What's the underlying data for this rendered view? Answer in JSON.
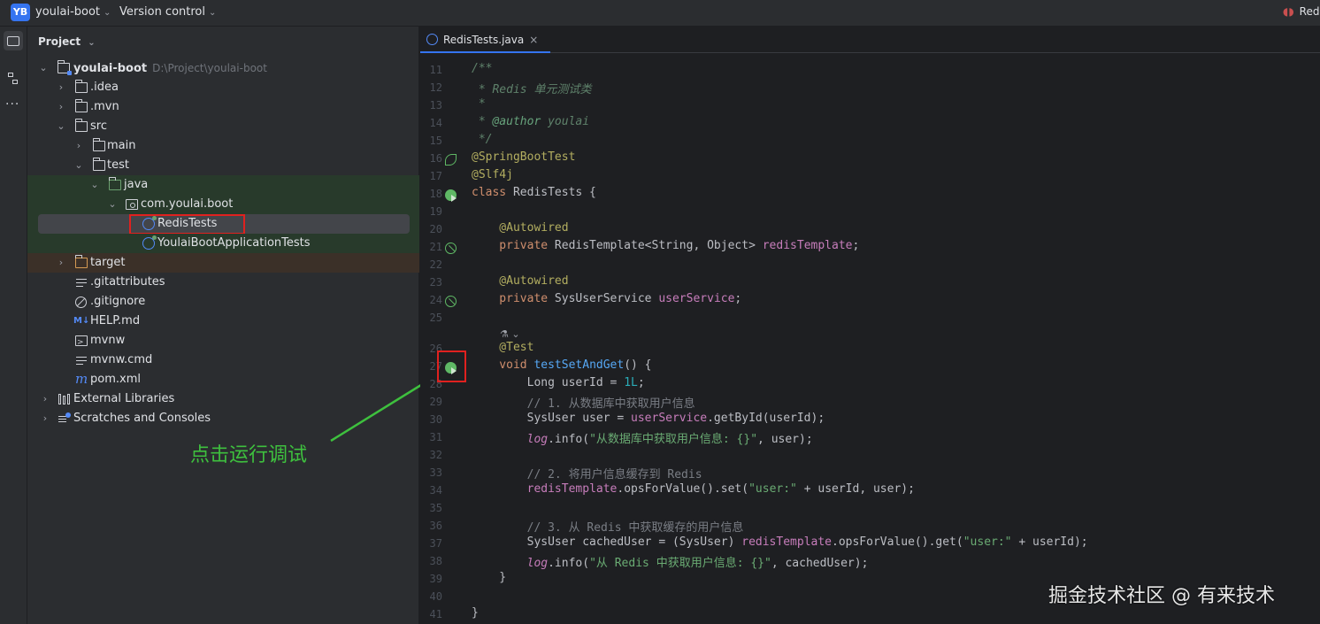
{
  "titlebar": {
    "badge": "YB",
    "project_name": "youlai-boot",
    "vcs_label": "Version control",
    "run_config": "Redi"
  },
  "project_panel": {
    "header": "Project",
    "tree": [
      {
        "label": "youlai-boot",
        "hint": "D:\\Project\\youlai-boot",
        "icon": "module-folder-icon"
      },
      {
        "label": ".idea",
        "icon": "folder-icon"
      },
      {
        "label": ".mvn",
        "icon": "folder-icon"
      },
      {
        "label": "src",
        "icon": "folder-icon"
      },
      {
        "label": "main",
        "icon": "folder-icon"
      },
      {
        "label": "test",
        "icon": "folder-icon"
      },
      {
        "label": "java",
        "icon": "test-source-folder-icon"
      },
      {
        "label": "com.youlai.boot",
        "icon": "package-icon"
      },
      {
        "label": "RedisTests",
        "icon": "test-class-icon"
      },
      {
        "label": "YoulaiBootApplicationTests",
        "icon": "test-class-icon"
      },
      {
        "label": "target",
        "icon": "excluded-folder-icon"
      },
      {
        "label": ".gitattributes",
        "icon": "text-file-icon"
      },
      {
        "label": ".gitignore",
        "icon": "ignore-file-icon"
      },
      {
        "label": "HELP.md",
        "icon": "markdown-icon"
      },
      {
        "label": "mvnw",
        "icon": "shell-script-icon"
      },
      {
        "label": "mvnw.cmd",
        "icon": "text-file-icon"
      },
      {
        "label": "pom.xml",
        "icon": "maven-icon"
      },
      {
        "label": "External Libraries",
        "icon": "library-icon"
      },
      {
        "label": "Scratches and Consoles",
        "icon": "scratch-icon"
      }
    ],
    "md_glyph": "M↓",
    "maven_glyph": "m"
  },
  "editor": {
    "tab_label": "RedisTests.java",
    "tab_close": "×",
    "line_numbers": [
      "11",
      "12",
      "13",
      "14",
      "15",
      "16",
      "17",
      "18",
      "19",
      "20",
      "21",
      "22",
      "23",
      "24",
      "25",
      "26",
      "27",
      "28",
      "29",
      "30",
      "31",
      "32",
      "33",
      "34",
      "35",
      "36",
      "37",
      "38",
      "39",
      "40",
      "41"
    ],
    "inlay_hint": "⚗ ⌄",
    "code": {
      "l11": "/**",
      "l12a": " * Redis ",
      "l12b": "单元测试类",
      "l13": " *",
      "l14a": " * ",
      "l14b": "@author",
      "l14c": " youlai",
      "l15": " */",
      "l16": "@SpringBootTest",
      "l17": "@Slf4j",
      "l18a": "class",
      "l18b": " RedisTests {",
      "l20": "    @Autowired",
      "l21a": "    private",
      "l21b": " RedisTemplate<String, Object> ",
      "l21c": "redisTemplate",
      "l21d": ";",
      "l23": "    @Autowired",
      "l24a": "    private",
      "l24b": " SysUserService ",
      "l24c": "userService",
      "l24d": ";",
      "l26": "    @Test",
      "l27a": "    void",
      "l27b": " testSetAndGet",
      "l27c": "() {",
      "l28a": "        Long userId = ",
      "l28b": "1L",
      "l28c": ";",
      "l29": "        // 1. 从数据库中获取用户信息",
      "l30a": "        SysUser user = ",
      "l30b": "userService",
      "l30c": ".getById(userId);",
      "l31a": "        ",
      "l31b": "log",
      "l31c": ".info(",
      "l31d": "\"从数据库中获取用户信息: {}\"",
      "l31e": ", user);",
      "l33": "        // 2. 将用户信息缓存到 Redis",
      "l34a": "        ",
      "l34b": "redisTemplate",
      "l34c": ".opsForValue().set(",
      "l34d": "\"user:\"",
      "l34e": " + userId, user);",
      "l36": "        // 3. 从 Redis 中获取缓存的用户信息",
      "l37a": "        SysUser cachedUser = (SysUser) ",
      "l37b": "redisTemplate",
      "l37c": ".opsForValue().get(",
      "l37d": "\"user:\"",
      "l37e": " + userId);",
      "l38a": "        ",
      "l38b": "log",
      "l38c": ".info(",
      "l38d": "\"从 Redis 中获取用户信息: {}\"",
      "l38e": ", cachedUser);",
      "l39": "    }",
      "l41": "}"
    }
  },
  "annotation": {
    "text": "点击运行调试",
    "color": "#3ec03e"
  },
  "watermark": "掘金技术社区 @ 有来技术",
  "colors": {
    "accent": "#3574f0",
    "highlight_red": "#e0211f",
    "run_green": "#5fb865"
  }
}
